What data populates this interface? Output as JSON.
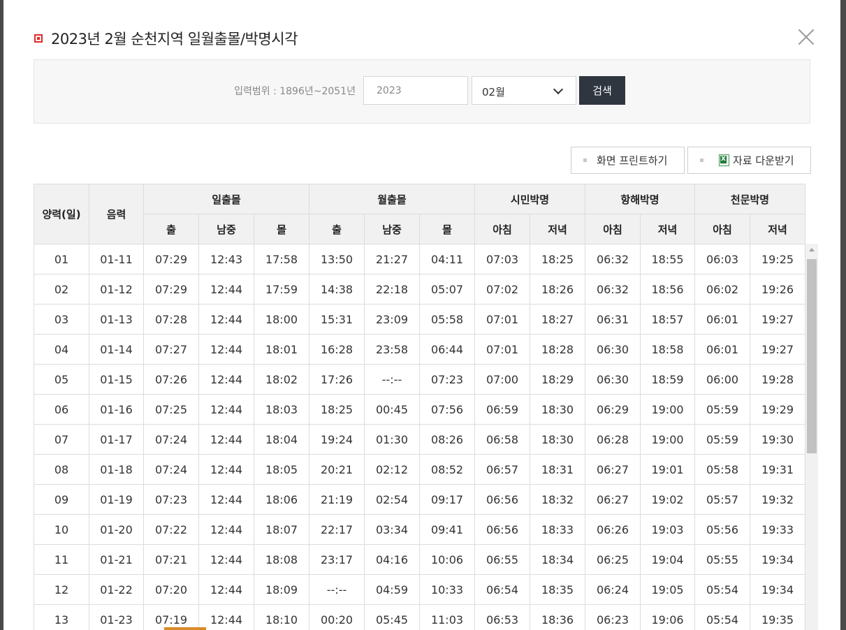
{
  "title": "2023년 2월 순천지역 일월출몰/박명시각",
  "search": {
    "range_label": "입력범위 : 1896년~2051년",
    "year_value": "2023",
    "month_value": "02월",
    "search_label": "검색"
  },
  "toolbar": {
    "print_label": "화면 프린트하기",
    "download_label": "자료 다운받기"
  },
  "table": {
    "headers": {
      "solar_date": "양력(일)",
      "lunar_date": "음력",
      "sun_group": "일출몰",
      "moon_group": "월출몰",
      "civil_group": "시민박명",
      "nautical_group": "항해박명",
      "astro_group": "천문박명",
      "sub": [
        "출",
        "남중",
        "몰",
        "출",
        "남중",
        "몰",
        "아침",
        "저녁",
        "아침",
        "저녁",
        "아침",
        "저녁"
      ]
    },
    "rows": [
      [
        "01",
        "01-11",
        "07:29",
        "12:43",
        "17:58",
        "13:50",
        "21:27",
        "04:11",
        "07:03",
        "18:25",
        "06:32",
        "18:55",
        "06:03",
        "19:25"
      ],
      [
        "02",
        "01-12",
        "07:29",
        "12:44",
        "17:59",
        "14:38",
        "22:18",
        "05:07",
        "07:02",
        "18:26",
        "06:32",
        "18:56",
        "06:02",
        "19:26"
      ],
      [
        "03",
        "01-13",
        "07:28",
        "12:44",
        "18:00",
        "15:31",
        "23:09",
        "05:58",
        "07:01",
        "18:27",
        "06:31",
        "18:57",
        "06:01",
        "19:27"
      ],
      [
        "04",
        "01-14",
        "07:27",
        "12:44",
        "18:01",
        "16:28",
        "23:58",
        "06:44",
        "07:01",
        "18:28",
        "06:30",
        "18:58",
        "06:01",
        "19:27"
      ],
      [
        "05",
        "01-15",
        "07:26",
        "12:44",
        "18:02",
        "17:26",
        "--:--",
        "07:23",
        "07:00",
        "18:29",
        "06:30",
        "18:59",
        "06:00",
        "19:28"
      ],
      [
        "06",
        "01-16",
        "07:25",
        "12:44",
        "18:03",
        "18:25",
        "00:45",
        "07:56",
        "06:59",
        "18:30",
        "06:29",
        "19:00",
        "05:59",
        "19:29"
      ],
      [
        "07",
        "01-17",
        "07:24",
        "12:44",
        "18:04",
        "19:24",
        "01:30",
        "08:26",
        "06:58",
        "18:30",
        "06:28",
        "19:00",
        "05:59",
        "19:30"
      ],
      [
        "08",
        "01-18",
        "07:24",
        "12:44",
        "18:05",
        "20:21",
        "02:12",
        "08:52",
        "06:57",
        "18:31",
        "06:27",
        "19:01",
        "05:58",
        "19:31"
      ],
      [
        "09",
        "01-19",
        "07:23",
        "12:44",
        "18:06",
        "21:19",
        "02:54",
        "09:17",
        "06:56",
        "18:32",
        "06:27",
        "19:02",
        "05:57",
        "19:32"
      ],
      [
        "10",
        "01-20",
        "07:22",
        "12:44",
        "18:07",
        "22:17",
        "03:34",
        "09:41",
        "06:56",
        "18:33",
        "06:26",
        "19:03",
        "05:56",
        "19:33"
      ],
      [
        "11",
        "01-21",
        "07:21",
        "12:44",
        "18:08",
        "23:17",
        "04:16",
        "10:06",
        "06:55",
        "18:34",
        "06:25",
        "19:04",
        "05:55",
        "19:34"
      ],
      [
        "12",
        "01-22",
        "07:20",
        "12:44",
        "18:09",
        "--:--",
        "04:59",
        "10:33",
        "06:54",
        "18:35",
        "06:24",
        "19:05",
        "05:54",
        "19:34"
      ],
      [
        "13",
        "01-23",
        "07:19",
        "12:44",
        "18:10",
        "00:20",
        "05:45",
        "11:03",
        "06:53",
        "18:36",
        "06:23",
        "19:06",
        "05:54",
        "19:35"
      ]
    ]
  },
  "colors": {
    "title_marker": "#e02a2a",
    "search_button": "#2f3640",
    "header_bg": "#f1f1f1"
  },
  "icons": [
    "close-icon",
    "chevron-down-icon",
    "excel-icon"
  ]
}
